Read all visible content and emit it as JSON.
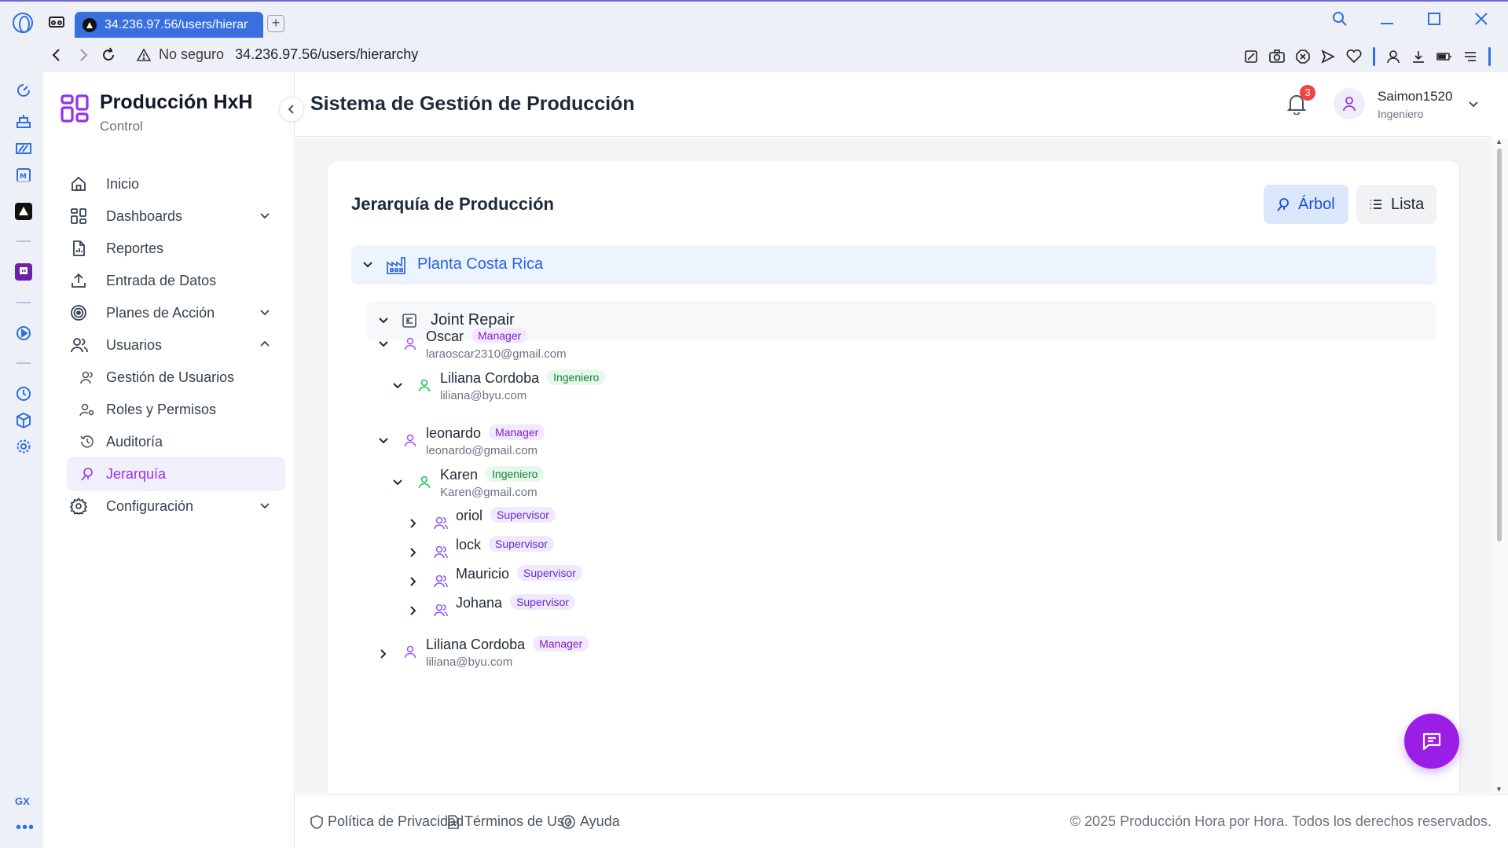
{
  "browser": {
    "tab_title": "34.236.97.56/users/hierar",
    "security_label": "No seguro",
    "url": "34.236.97.56/users/hierarchy",
    "accent_color": "#2f6fe0"
  },
  "side_panel": {
    "gx_label": "GX",
    "more_label": "•••"
  },
  "brand": {
    "title": "Producción HxH",
    "subtitle": "Control"
  },
  "nav": {
    "inicio": "Inicio",
    "dashboards": "Dashboards",
    "reportes": "Reportes",
    "entrada": "Entrada de Datos",
    "planes": "Planes de Acción",
    "usuarios": "Usuarios",
    "gestion": "Gestión de Usuarios",
    "roles": "Roles y Permisos",
    "auditoria": "Auditoría",
    "jerarquia": "Jerarquía",
    "configuracion": "Configuración"
  },
  "header": {
    "title": "Sistema de Gestión de Producción",
    "notifications_count": "3",
    "user_name": "Saimon1520",
    "user_role": "Ingeniero"
  },
  "card": {
    "title": "Jerarquía de Producción",
    "tree_label": "Árbol",
    "list_label": "Lista"
  },
  "hierarchy": {
    "plant": "Planta Costa Rica",
    "line": "Joint Repair",
    "oscar": {
      "name": "Oscar",
      "role": "Manager",
      "email": "laraoscar2310@gmail.com"
    },
    "liliana1": {
      "name": "Liliana Cordoba",
      "role": "Ingeniero",
      "email": "liliana@byu.com"
    },
    "leonardo": {
      "name": "leonardo",
      "role": "Manager",
      "email": "leonardo@gmail.com"
    },
    "karen": {
      "name": "Karen",
      "role": "Ingeniero",
      "email": "Karen@gmail.com"
    },
    "oriol": {
      "name": "oriol",
      "role": "Supervisor"
    },
    "lock": {
      "name": "lock",
      "role": "Supervisor"
    },
    "mauricio": {
      "name": "Mauricio",
      "role": "Supervisor"
    },
    "johana": {
      "name": "Johana",
      "role": "Supervisor"
    },
    "liliana2": {
      "name": "Liliana Cordoba",
      "role": "Manager",
      "email": "liliana@byu.com"
    }
  },
  "footer": {
    "privacy": "Política de Privacidad",
    "terms": "Términos de Uso",
    "help": "Ayuda",
    "copyright": "© 2025 Producción Hora por Hora. Todos los derechos reservados."
  },
  "colors": {
    "primary": "#9333ea",
    "fab": "#9a1ee6",
    "tree_active": "#dbe8fb"
  }
}
